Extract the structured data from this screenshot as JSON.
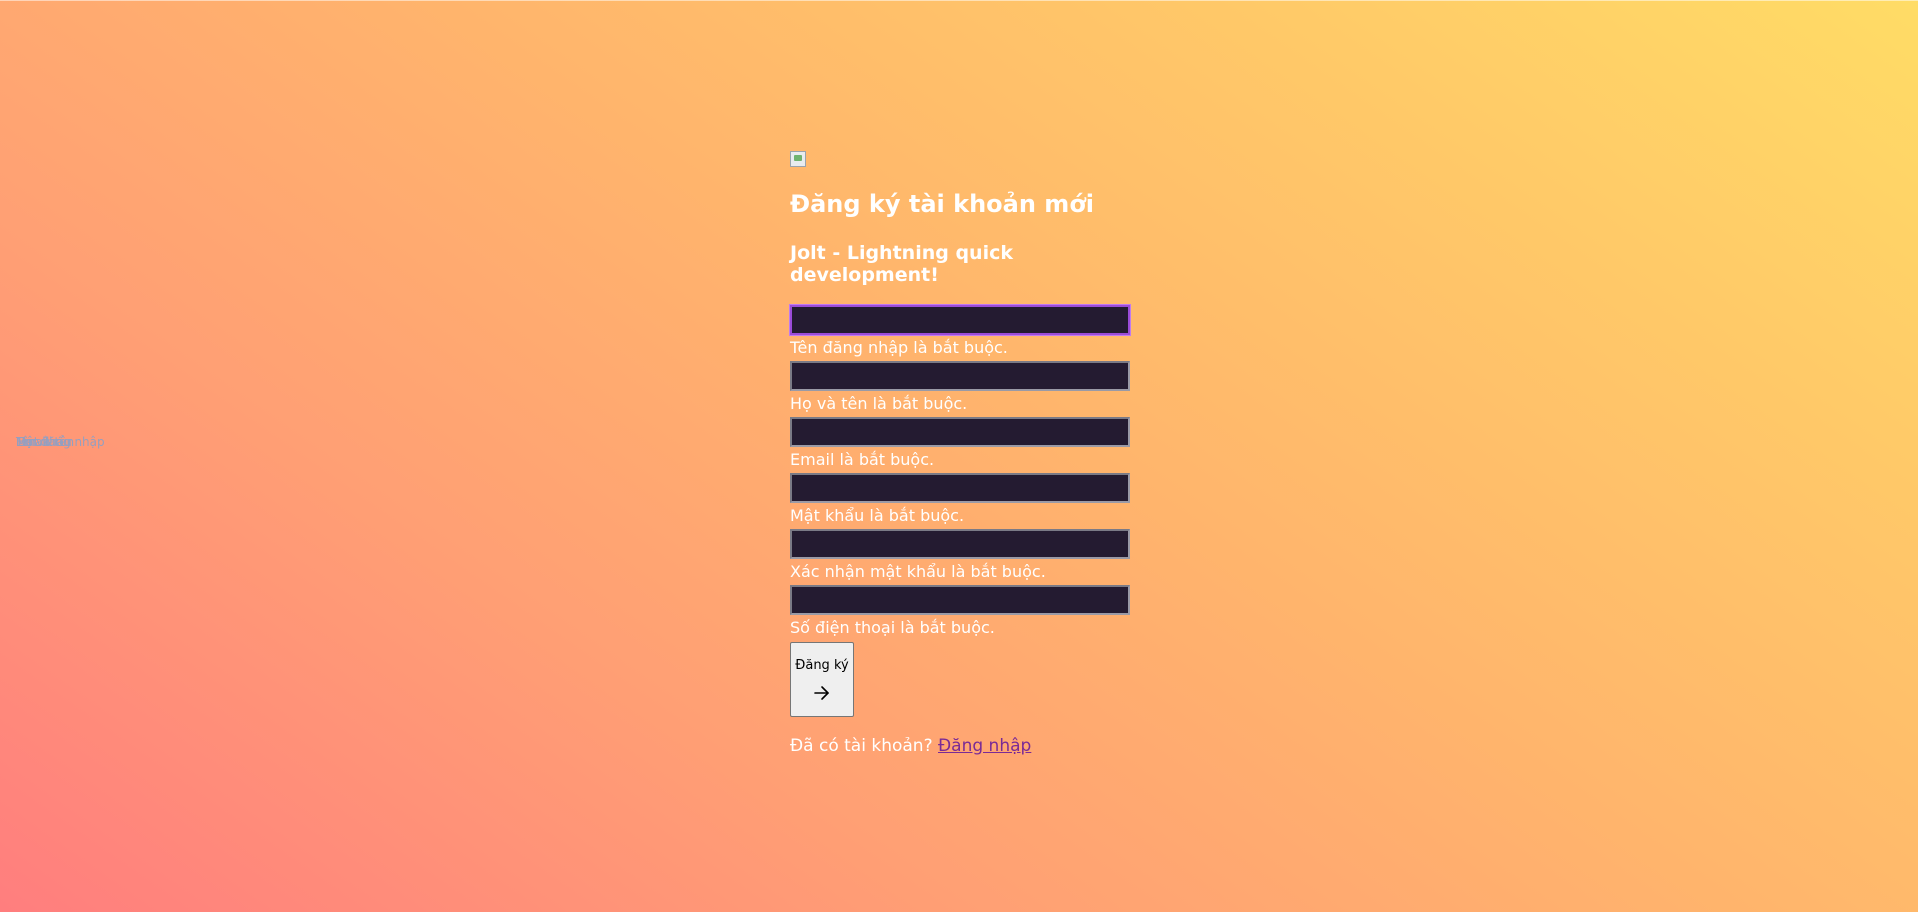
{
  "page": {
    "title": "Đăng ký tài khoản mới",
    "subtitle": "Jolt - Lightning quick development!"
  },
  "logo": {
    "icon": "broken-image-icon"
  },
  "fields": [
    {
      "id": "username",
      "value": "",
      "error": "Tên đăng nhập là bắt buộc."
    },
    {
      "id": "fullname",
      "value": "",
      "error": "Họ và tên là bắt buộc."
    },
    {
      "id": "email",
      "value": "",
      "error": "Email là bắt buộc."
    },
    {
      "id": "password",
      "value": "",
      "error": "Mật khẩu là bắt buộc."
    },
    {
      "id": "confirm_password",
      "value": "",
      "error": "Xác nhận mật khẩu là bắt buộc."
    },
    {
      "id": "phone",
      "value": "",
      "error": "Số điện thoại là bắt buộc."
    }
  ],
  "submit": {
    "label": "Đăng ký",
    "icon": "arrow-right-icon"
  },
  "footer": {
    "prompt": "Đã có tài khoản?",
    "login_link": "Đăng nhập"
  },
  "overlapped_placeholders": [
    "Tên đăng nhập",
    "Họ và tên",
    "Email",
    "Mật khẩu"
  ],
  "colors": {
    "input_bg": "#241b31",
    "focus_border": "#9b4cd8",
    "link": "#7a2a96",
    "text": "#ffffff"
  }
}
